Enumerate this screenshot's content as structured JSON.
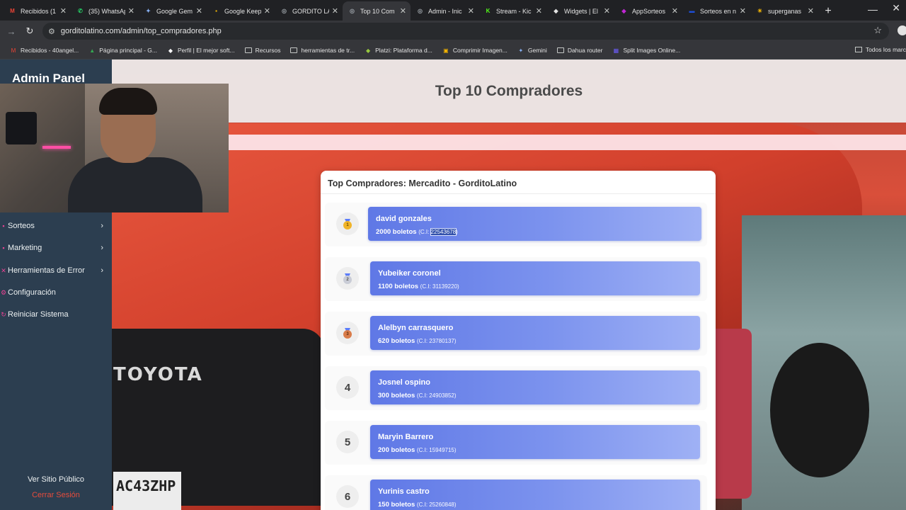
{
  "browser": {
    "tabs": [
      {
        "title": "Recibidos (1",
        "color": "#ea4335",
        "glyph": "M"
      },
      {
        "title": "(35) WhatsAp",
        "color": "#25d366",
        "glyph": "✆"
      },
      {
        "title": "Google Gem",
        "color": "#8ab4f8",
        "glyph": "✦"
      },
      {
        "title": "Google Keep",
        "color": "#fbbc04",
        "glyph": "▪"
      },
      {
        "title": "GORDITO LA",
        "color": "#9aa0a6",
        "glyph": "◎"
      },
      {
        "title": "Top 10 Com",
        "color": "#9aa0a6",
        "glyph": "◎"
      },
      {
        "title": "Admin - Inic",
        "color": "#9aa0a6",
        "glyph": "◎"
      },
      {
        "title": "Stream - Kic",
        "color": "#53fc18",
        "glyph": "K"
      },
      {
        "title": "Widgets | El",
        "color": "#e3e3e3",
        "glyph": "◆"
      },
      {
        "title": "AppSorteos",
        "color": "#c026d3",
        "glyph": "◆"
      },
      {
        "title": "Sorteos en n",
        "color": "#1d4ed8",
        "glyph": "▬"
      },
      {
        "title": "superganas",
        "color": "#fbbc04",
        "glyph": "☀"
      }
    ],
    "active_tab": 5,
    "url": "gorditolatino.com/admin/top_compradores.php",
    "bookmarks": [
      {
        "label": "Recibidos - 40angel...",
        "color": "#ea4335",
        "glyph": "M",
        "folder": false
      },
      {
        "label": "Página principal - G...",
        "color": "#34a853",
        "glyph": "▲",
        "folder": false
      },
      {
        "label": "Perfil | El mejor soft...",
        "color": "#ffffff",
        "glyph": "◆",
        "folder": false
      },
      {
        "label": "Recursos",
        "color": "",
        "glyph": "",
        "folder": true
      },
      {
        "label": "herramientas de tr...",
        "color": "",
        "glyph": "",
        "folder": true
      },
      {
        "label": "Platzi: Plataforma d...",
        "color": "#98ca3f",
        "glyph": "◆",
        "folder": false
      },
      {
        "label": "Comprimir Imagen...",
        "color": "#f4b400",
        "glyph": "▣",
        "folder": false
      },
      {
        "label": "Gemini",
        "color": "#8ab4f8",
        "glyph": "✦",
        "folder": false
      },
      {
        "label": "Dahua router",
        "color": "",
        "glyph": "",
        "folder": true
      },
      {
        "label": "Split Images Online...",
        "color": "#6d5dfc",
        "glyph": "▦",
        "folder": false
      }
    ],
    "all_bookmarks": "Todos los marc"
  },
  "sidebar": {
    "brand": "Admin Panel",
    "items": [
      {
        "label": "Sorteos",
        "icon": "▪",
        "chevron": true
      },
      {
        "label": "Marketing",
        "icon": "▪",
        "chevron": true
      },
      {
        "label": "Herramientas de Error",
        "icon": "✕",
        "chevron": true
      },
      {
        "label": "Configuración",
        "icon": "⚙",
        "chevron": false
      },
      {
        "label": "Reiniciar Sistema",
        "icon": "↻",
        "chevron": false
      }
    ],
    "public_link": "Ver Sitio Público",
    "logout": "Cerrar Sesión"
  },
  "page": {
    "title": "Top 10 Compradores",
    "card_title": "Top Compradores: Mercadito - GorditoLatino",
    "ci_prefix": "C.I: ",
    "buyers": [
      {
        "rank": "1",
        "medal": "gold",
        "name": "david gonzales",
        "tickets": "2000 boletos",
        "ci": "22543678"
      },
      {
        "rank": "2",
        "medal": "silver",
        "name": "Yubeiker coronel",
        "tickets": "1100 boletos",
        "ci": "31139220"
      },
      {
        "rank": "3",
        "medal": "bronze",
        "name": "Alelbyn carrasquero",
        "tickets": "620 boletos",
        "ci": "23780137"
      },
      {
        "rank": "4",
        "medal": "",
        "name": "Josnel ospino",
        "tickets": "300 boletos",
        "ci": "24903852"
      },
      {
        "rank": "5",
        "medal": "",
        "name": "Maryin Barrero",
        "tickets": "200 boletos",
        "ci": "15949715"
      },
      {
        "rank": "6",
        "medal": "",
        "name": "Yurinis castro",
        "tickets": "150 boletos",
        "ci": "25260848"
      }
    ]
  },
  "background": {
    "brand_text": "TOYOTA",
    "plate_text": "AC43ZHP"
  }
}
